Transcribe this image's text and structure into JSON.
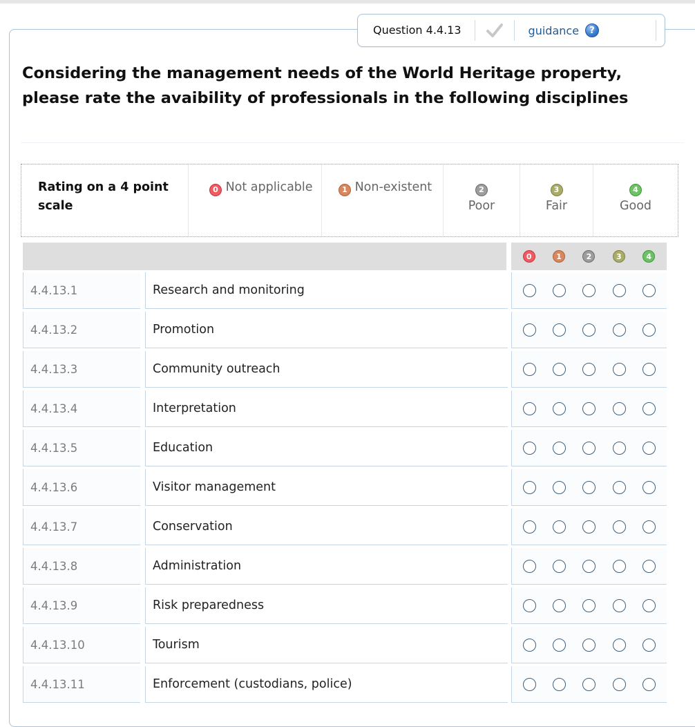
{
  "question": {
    "label": "Question 4.4.13",
    "guidance_label": "guidance",
    "guidance_icon": "?",
    "title": "Considering the management needs of the World Heritage property, please rate the avaibility of professionals in the following disciplines"
  },
  "legend": {
    "heading": "Rating on a 4 point scale",
    "items": [
      {
        "num": "0",
        "label": "Not applicable",
        "color": "#ee5b62"
      },
      {
        "num": "1",
        "label": "Non-existent",
        "color": "#d7885f"
      },
      {
        "num": "2",
        "label": "Poor",
        "color": "#9d9d9d"
      },
      {
        "num": "3",
        "label": "Fair",
        "color": "#a9ad69"
      },
      {
        "num": "4",
        "label": "Good",
        "color": "#6cc264"
      }
    ]
  },
  "rows": [
    {
      "code": "4.4.13.1",
      "label": "Research and monitoring"
    },
    {
      "code": "4.4.13.2",
      "label": "Promotion"
    },
    {
      "code": "4.4.13.3",
      "label": "Community outreach"
    },
    {
      "code": "4.4.13.4",
      "label": "Interpretation"
    },
    {
      "code": "4.4.13.5",
      "label": "Education"
    },
    {
      "code": "4.4.13.6",
      "label": "Visitor management"
    },
    {
      "code": "4.4.13.7",
      "label": "Conservation"
    },
    {
      "code": "4.4.13.8",
      "label": "Administration"
    },
    {
      "code": "4.4.13.9",
      "label": "Risk preparedness"
    },
    {
      "code": "4.4.13.10",
      "label": "Tourism"
    },
    {
      "code": "4.4.13.11",
      "label": "Enforcement (custodians, police)"
    }
  ]
}
